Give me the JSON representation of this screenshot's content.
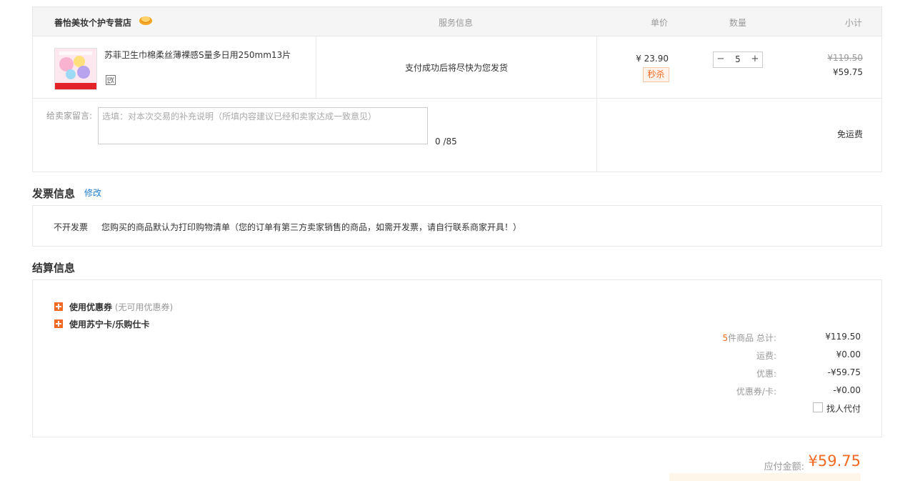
{
  "order": {
    "store_name": "善怡美妆个护专营店",
    "headers": {
      "service": "服务信息",
      "unit_price": "单价",
      "quantity": "数量",
      "subtotal": "小计"
    },
    "product": {
      "title": "苏菲卫生巾棉柔丝薄裸感S量多日用250mm13片",
      "service_text": "支付成功后将尽快为您发货",
      "unit_price": "¥ 23.90",
      "badge": "秒杀",
      "quantity": "5",
      "original_total": "¥119.50",
      "subtotal": "¥59.75"
    },
    "message": {
      "label": "给卖家留言:",
      "placeholder": "选填：对本次交易的补充说明（所填内容建议已经和卖家达成一致意见）",
      "count": "0 /85"
    },
    "shipping": "免运费"
  },
  "invoice": {
    "title": "发票信息",
    "edit_label": "修改",
    "type": "不开发票",
    "note": "您购买的商品默认为打印购物清单（您的订单有第三方卖家销售的商品，如需开发票，请自行联系商家开具！）"
  },
  "settlement": {
    "title": "结算信息",
    "coupon_label": "使用优惠券",
    "coupon_note": "(无可用优惠券)",
    "card_label": "使用苏宁卡/乐购仕卡",
    "summary": {
      "item_count": "5",
      "items_total_label": "件商品 总计:",
      "items_total": "¥119.50",
      "shipping_label": "运费:",
      "shipping": "¥0.00",
      "discount_label": "优惠:",
      "discount": "-¥59.75",
      "coupon_card_label": "优惠券/卡:",
      "coupon_card": "-¥0.00"
    },
    "proxy_pay_label": "找人代付"
  },
  "payment": {
    "label": "应付金额:",
    "amount": "¥59.75"
  },
  "colors": {
    "accent": "#f26a21",
    "link": "#1e7bcc",
    "border": "#e8e8e8"
  }
}
